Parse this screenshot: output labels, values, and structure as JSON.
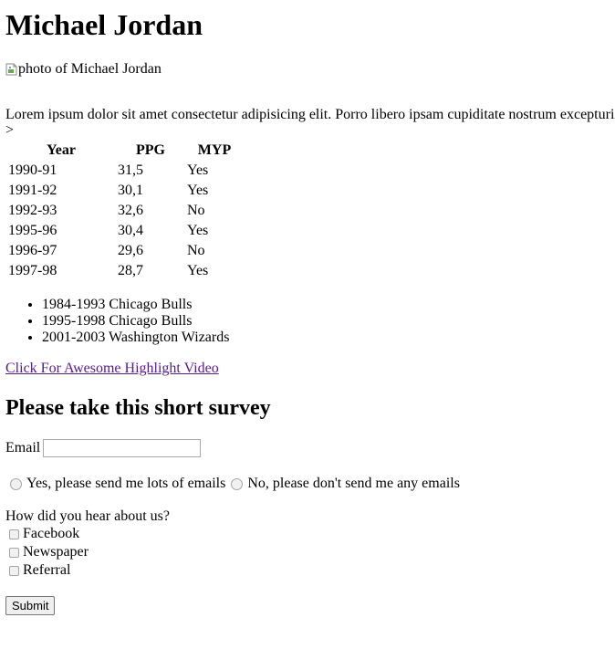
{
  "title": "Michael Jordan",
  "photo": {
    "alt": "photo of Michael Jordan",
    "icon": "broken-image-icon"
  },
  "intro": "Lorem ipsum dolor sit amet consectetur adipisicing elit. Porro libero ipsam cupiditate nostrum excepturi",
  "stray_text": ">",
  "stats_table": {
    "headers": [
      "Year",
      "PPG",
      "MYP"
    ],
    "rows": [
      [
        "1990-91",
        "31,5",
        "Yes"
      ],
      [
        "1991-92",
        "30,1",
        "Yes"
      ],
      [
        "1992-93",
        "32,6",
        "No"
      ],
      [
        "1995-96",
        "30,4",
        "Yes"
      ],
      [
        "1996-97",
        "29,6",
        "No"
      ],
      [
        "1997-98",
        "28,7",
        "Yes"
      ]
    ]
  },
  "teams": [
    "1984-1993 Chicago Bulls",
    "1995-1998 Chicago Bulls",
    "2001-2003 Washington Wizards"
  ],
  "video_link": "Click For Awesome Highlight Video",
  "survey": {
    "heading": "Please take this short survey",
    "email_label": "Email",
    "email_value": "",
    "radio_yes": "Yes, please send me lots of emails",
    "radio_no": "No, please don't send me any emails",
    "hear_question": "How did you hear about us?",
    "checkboxes": [
      "Facebook",
      "Newspaper",
      "Referral"
    ],
    "submit_label": "Submit"
  },
  "colors": {
    "link_visited": "#551a8b",
    "text": "#000000",
    "background": "#ffffff"
  }
}
